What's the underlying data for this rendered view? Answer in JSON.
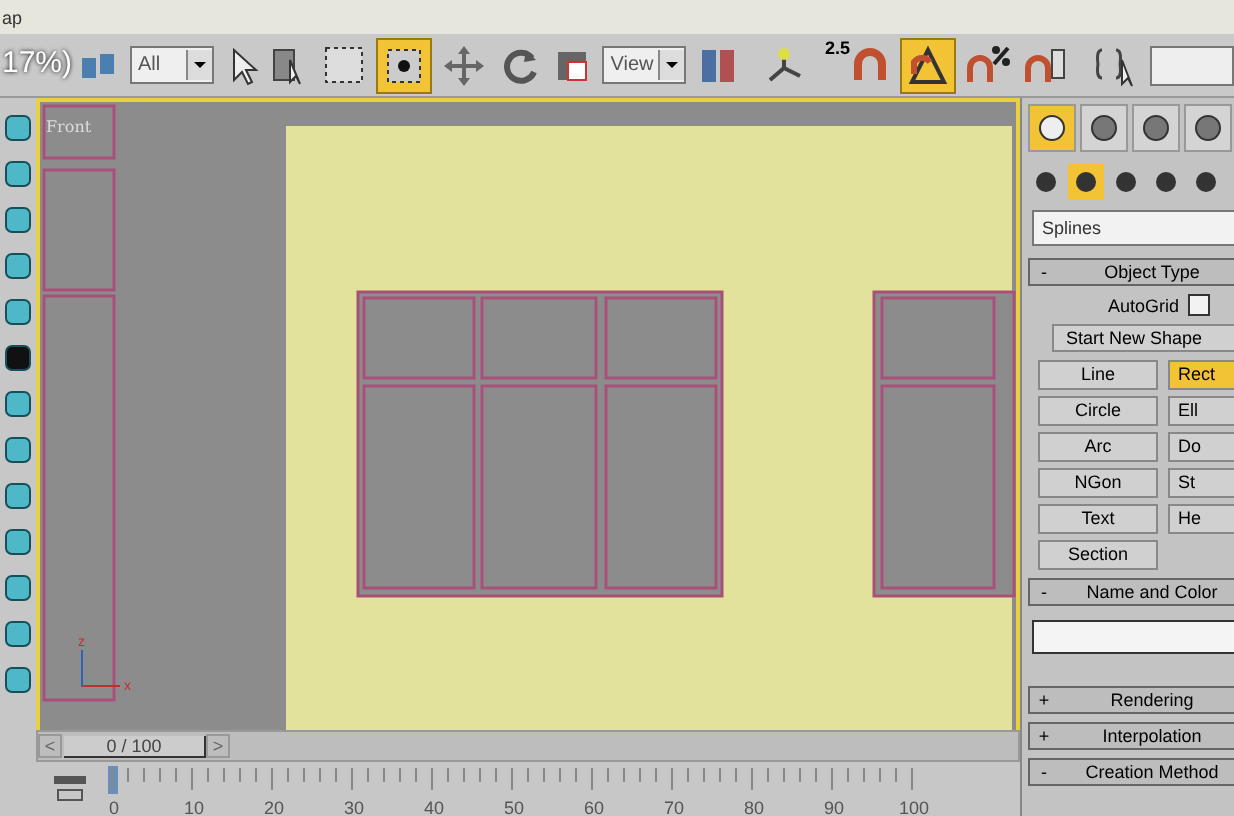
{
  "title_fragment": "ap",
  "toolbar": {
    "zoom_overlay": "17%)",
    "selection_filter": "All",
    "reference_coord": "View",
    "snap_spinner": "2.5",
    "window_crossing_selected": true,
    "angle_snap_selected": true
  },
  "viewport": {
    "label": "Front",
    "axis_labels": [
      "z",
      "x"
    ]
  },
  "command_panel": {
    "tabs": [
      {
        "selected": true
      },
      {
        "selected": false
      },
      {
        "selected": false
      },
      {
        "selected": false
      }
    ],
    "categories": [
      {
        "selected": false
      },
      {
        "selected": true
      },
      {
        "selected": false
      },
      {
        "selected": false
      },
      {
        "selected": false
      }
    ],
    "category_dropdown": "Splines",
    "rollouts": [
      {
        "kind": "object_type",
        "sign": "-",
        "title": "Object Type",
        "autogrid_label": "AutoGrid",
        "autogrid_checked": false,
        "start_new_shape": "Start New Shape",
        "buttons": [
          {
            "label": "Line",
            "selected": false
          },
          {
            "label": "Rect",
            "selected": true
          },
          {
            "label": "Circle",
            "selected": false
          },
          {
            "label": "Ell",
            "selected": false
          },
          {
            "label": "Arc",
            "selected": false
          },
          {
            "label": "Do",
            "selected": false
          },
          {
            "label": "NGon",
            "selected": false
          },
          {
            "label": "St",
            "selected": false
          },
          {
            "label": "Text",
            "selected": false
          },
          {
            "label": "He",
            "selected": false
          },
          {
            "label": "Section",
            "selected": false
          }
        ]
      },
      {
        "kind": "name_color",
        "sign": "-",
        "title": "Name and Color"
      },
      {
        "kind": "collapsed",
        "sign": "+",
        "title": "Rendering"
      },
      {
        "kind": "collapsed",
        "sign": "+",
        "title": "Interpolation"
      },
      {
        "kind": "collapsed",
        "sign": "-",
        "title": "Creation Method"
      }
    ]
  },
  "time_slider": {
    "prev": "<",
    "position": "0 / 100",
    "next": ">",
    "level": 0
  },
  "track_bar": {
    "labels": [
      "0",
      "10",
      "20",
      "30",
      "40",
      "50",
      "60",
      "70",
      "80",
      "90",
      "100"
    ]
  }
}
